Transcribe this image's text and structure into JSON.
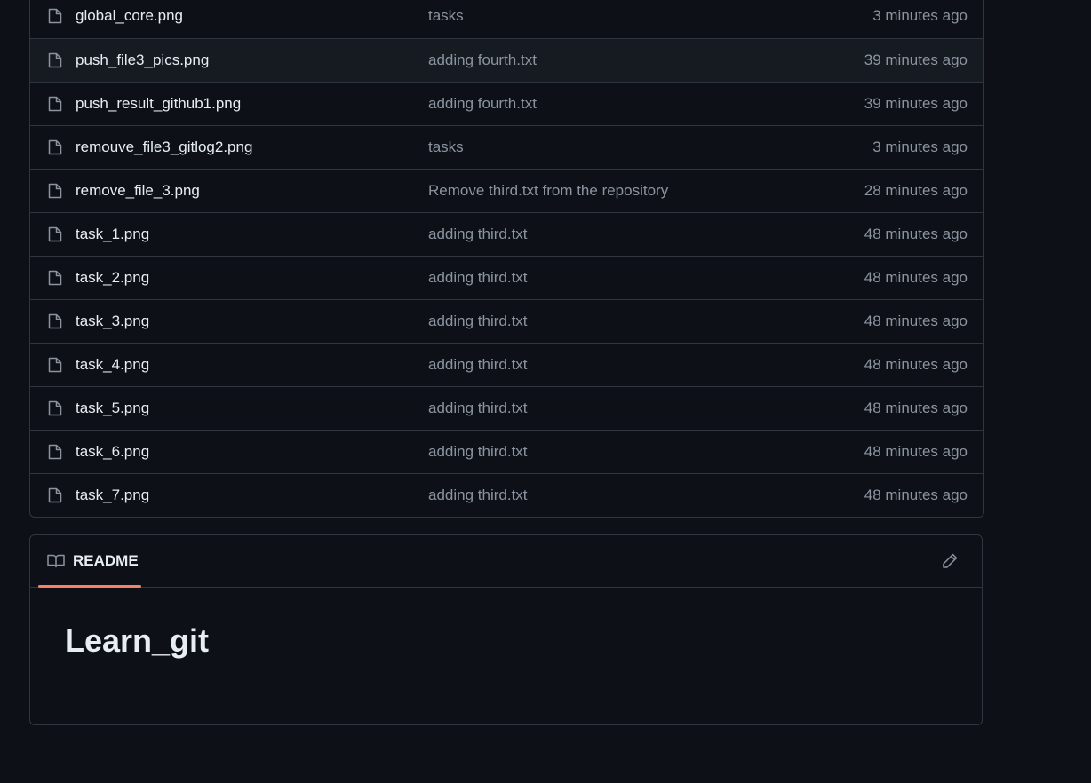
{
  "files": [
    {
      "name": "global_core.png",
      "message": "tasks",
      "time": "3 minutes ago"
    },
    {
      "name": "push_file3_pics.png",
      "message": "adding fourth.txt",
      "time": "39 minutes ago"
    },
    {
      "name": "push_result_github1.png",
      "message": "adding fourth.txt",
      "time": "39 minutes ago"
    },
    {
      "name": "remouve_file3_gitlog2.png",
      "message": "tasks",
      "time": "3 minutes ago"
    },
    {
      "name": "remove_file_3.png",
      "message": "Remove third.txt from the repository",
      "time": "28 minutes ago"
    },
    {
      "name": "task_1.png",
      "message": "adding third.txt",
      "time": "48 minutes ago"
    },
    {
      "name": "task_2.png",
      "message": "adding third.txt",
      "time": "48 minutes ago"
    },
    {
      "name": "task_3.png",
      "message": "adding third.txt",
      "time": "48 minutes ago"
    },
    {
      "name": "task_4.png",
      "message": "adding third.txt",
      "time": "48 minutes ago"
    },
    {
      "name": "task_5.png",
      "message": "adding third.txt",
      "time": "48 minutes ago"
    },
    {
      "name": "task_6.png",
      "message": "adding third.txt",
      "time": "48 minutes ago"
    },
    {
      "name": "task_7.png",
      "message": "adding third.txt",
      "time": "48 minutes ago"
    }
  ],
  "readme": {
    "tab_label": "README",
    "title": "Learn_git",
    "tab_icon": "book-icon",
    "edit_icon": "pencil-icon"
  },
  "colors": {
    "background": "#0d1117",
    "border": "#30363d",
    "text_primary": "#e6edf3",
    "text_muted": "#8b949e",
    "tab_accent": "#f78166"
  }
}
